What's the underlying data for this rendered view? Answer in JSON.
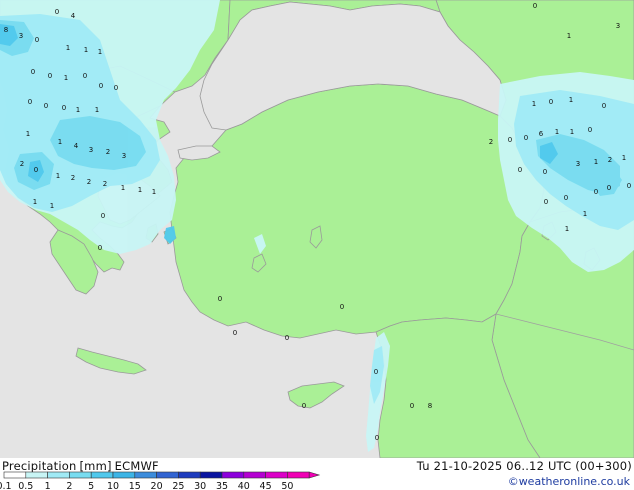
{
  "footer": {
    "title_label": "Precipitation",
    "unit": "[mm]",
    "model": "ECMWF",
    "datetime": "Tu 21-10-2025 06..12 UTC (00+300)",
    "credit": "©weatheronline.co.uk"
  },
  "legend": {
    "ticks": [
      "0.1",
      "0.5",
      "1",
      "2",
      "5",
      "10",
      "15",
      "20",
      "25",
      "30",
      "35",
      "40",
      "45",
      "50"
    ],
    "colors": [
      "#ffffff",
      "#c8f5f5",
      "#a0eaf5",
      "#78dcf0",
      "#50c8ec",
      "#3cb4e6",
      "#3c8cdc",
      "#3264d2",
      "#1e3cbe",
      "#0a14a0",
      "#8c00dc",
      "#b400d2",
      "#dc00c8",
      "#f000b4"
    ]
  },
  "colors": {
    "sea": "#e4e4e4",
    "land": "#aaf096",
    "border": "#a0a0a0",
    "coast": "#9a9a9a",
    "precip_light": "#c8f5f5",
    "precip_mid": "#a0eaf5",
    "precip_high": "#78dcf0",
    "precip_max": "#50c8ec"
  },
  "map_labels": [
    {
      "text": "0"
    },
    {
      "text": "4"
    },
    {
      "text": "3"
    },
    {
      "text": "8"
    },
    {
      "text": "0"
    },
    {
      "text": "1"
    },
    {
      "text": "1"
    },
    {
      "text": "1"
    },
    {
      "text": "0"
    },
    {
      "text": "0"
    },
    {
      "text": "1"
    },
    {
      "text": "0"
    },
    {
      "text": "0"
    },
    {
      "text": "0"
    },
    {
      "text": "0"
    },
    {
      "text": "0"
    },
    {
      "text": "0"
    },
    {
      "text": "1"
    },
    {
      "text": "1"
    },
    {
      "text": "1"
    },
    {
      "text": "4"
    },
    {
      "text": "3"
    },
    {
      "text": "2"
    },
    {
      "text": "3"
    },
    {
      "text": "1"
    },
    {
      "text": "2"
    },
    {
      "text": "0"
    },
    {
      "text": "1"
    },
    {
      "text": "2"
    },
    {
      "text": "2"
    },
    {
      "text": "2"
    },
    {
      "text": "1"
    },
    {
      "text": "1"
    },
    {
      "text": "1"
    },
    {
      "text": "1"
    },
    {
      "text": "1"
    },
    {
      "text": "0"
    },
    {
      "text": "0"
    },
    {
      "text": "0"
    },
    {
      "text": "0"
    },
    {
      "text": "0"
    },
    {
      "text": "0"
    },
    {
      "text": "0"
    },
    {
      "text": "0"
    },
    {
      "text": "0"
    },
    {
      "text": "8"
    },
    {
      "text": "0"
    },
    {
      "text": "1"
    },
    {
      "text": "0"
    },
    {
      "text": "1"
    },
    {
      "text": "0"
    },
    {
      "text": "2"
    },
    {
      "text": "0"
    },
    {
      "text": "0"
    },
    {
      "text": "6"
    },
    {
      "text": "1"
    },
    {
      "text": "1"
    },
    {
      "text": "0"
    },
    {
      "text": "3"
    },
    {
      "text": "1"
    },
    {
      "text": "0"
    },
    {
      "text": "0"
    },
    {
      "text": "3"
    },
    {
      "text": "1"
    },
    {
      "text": "2"
    },
    {
      "text": "1"
    },
    {
      "text": "0"
    },
    {
      "text": "0"
    },
    {
      "text": "0"
    },
    {
      "text": "0"
    },
    {
      "text": "0"
    },
    {
      "text": "0"
    },
    {
      "text": "1"
    },
    {
      "text": "1"
    }
  ]
}
